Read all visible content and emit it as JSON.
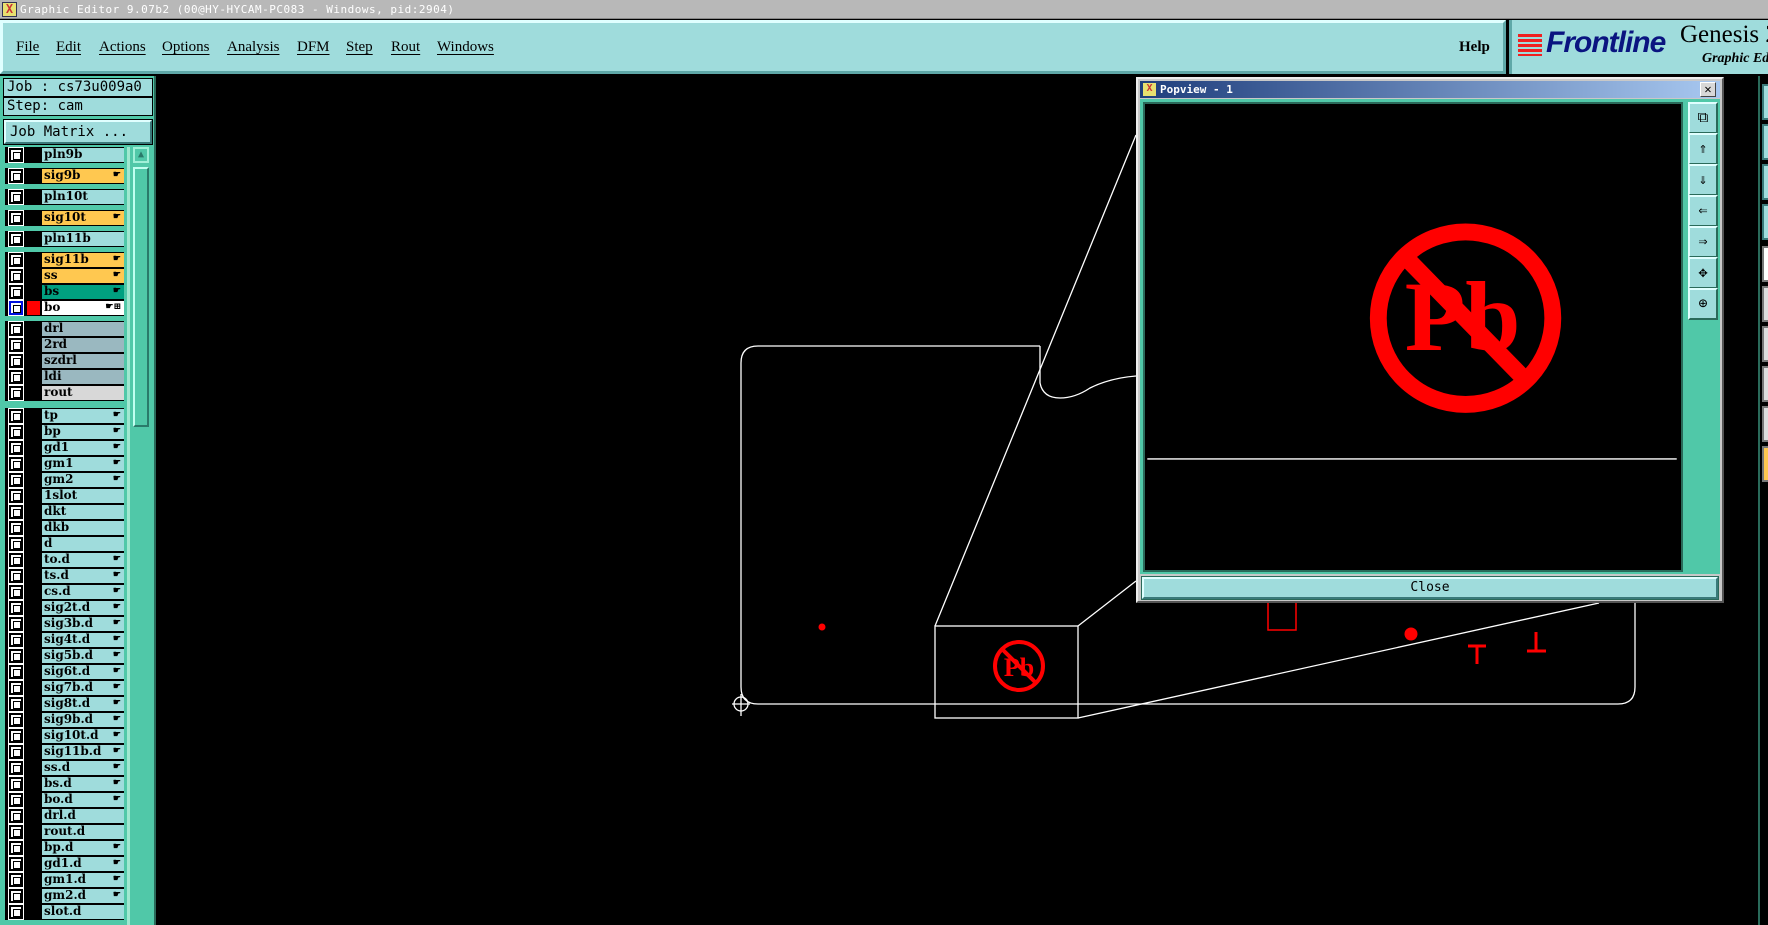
{
  "window": {
    "title": "Graphic Editor 9.07b2 (00@HY-HYCAM-PC083 - Windows, pid:2904)",
    "icon": "x-window-icon"
  },
  "menu": [
    "File",
    "Edit",
    "Actions",
    "Options",
    "Analysis",
    "DFM",
    "Step",
    "Rout",
    "Windows"
  ],
  "help": "Help",
  "logo": {
    "brand": "Frontline",
    "product": "Genesis 2",
    "subtitle": "Graphic Ed"
  },
  "job": {
    "job_label": "Job : cs73u009a0",
    "step_label": "Step: cam",
    "matrix_button": "Job Matrix ..."
  },
  "layer_colors": {
    "pln": "#9fdcdc",
    "sig": "#ffc850",
    "green": "#00a080",
    "white": "#ffffff",
    "gray": "#9ab8c0",
    "light": "#d8d8d8"
  },
  "layers": [
    {
      "name": "pln9b",
      "type": "pln"
    },
    {
      "name": "sig9b",
      "type": "sig",
      "hand": true,
      "gap": 5
    },
    {
      "name": "pln10t",
      "type": "pln",
      "gap": 5
    },
    {
      "name": "sig10t",
      "type": "sig",
      "hand": true,
      "gap": 5
    },
    {
      "name": "pln11b",
      "type": "pln",
      "gap": 5
    },
    {
      "name": "sig11b",
      "type": "sig",
      "hand": true,
      "gap": 5
    },
    {
      "name": "ss",
      "type": "sig",
      "hand": true
    },
    {
      "name": "bs",
      "type": "green",
      "hand": true
    },
    {
      "name": "bo",
      "type": "white",
      "hand": true,
      "active": true
    },
    {
      "name": "drl",
      "type": "gray",
      "gap": 5
    },
    {
      "name": "2rd",
      "type": "gray"
    },
    {
      "name": "szdrl",
      "type": "gray"
    },
    {
      "name": "ldi",
      "type": "gray"
    },
    {
      "name": "rout",
      "type": "light"
    },
    {
      "name": "tp",
      "type": "pln",
      "hand": true,
      "gap": 7
    },
    {
      "name": "bp",
      "type": "pln",
      "hand": true
    },
    {
      "name": "gd1",
      "type": "pln",
      "hand": true
    },
    {
      "name": "gm1",
      "type": "pln",
      "hand": true
    },
    {
      "name": "gm2",
      "type": "pln",
      "hand": true
    },
    {
      "name": "1slot",
      "type": "pln"
    },
    {
      "name": "dkt",
      "type": "pln"
    },
    {
      "name": "dkb",
      "type": "pln"
    },
    {
      "name": "d",
      "type": "pln"
    },
    {
      "name": "to.d",
      "type": "pln",
      "hand": true
    },
    {
      "name": "ts.d",
      "type": "pln",
      "hand": true
    },
    {
      "name": "cs.d",
      "type": "pln",
      "hand": true
    },
    {
      "name": "sig2t.d",
      "type": "pln",
      "hand": true
    },
    {
      "name": "sig3b.d",
      "type": "pln",
      "hand": true
    },
    {
      "name": "sig4t.d",
      "type": "pln",
      "hand": true
    },
    {
      "name": "sig5b.d",
      "type": "pln",
      "hand": true
    },
    {
      "name": "sig6t.d",
      "type": "pln",
      "hand": true
    },
    {
      "name": "sig7b.d",
      "type": "pln",
      "hand": true
    },
    {
      "name": "sig8t.d",
      "type": "pln",
      "hand": true
    },
    {
      "name": "sig9b.d",
      "type": "pln",
      "hand": true
    },
    {
      "name": "sig10t.d",
      "type": "pln",
      "hand": true
    },
    {
      "name": "sig11b.d",
      "type": "pln",
      "hand": true
    },
    {
      "name": "ss.d",
      "type": "pln",
      "hand": true
    },
    {
      "name": "bs.d",
      "type": "pln",
      "hand": true
    },
    {
      "name": "bo.d",
      "type": "pln",
      "hand": true
    },
    {
      "name": "drl.d",
      "type": "pln"
    },
    {
      "name": "rout.d",
      "type": "pln"
    },
    {
      "name": "bp.d",
      "type": "pln",
      "hand": true
    },
    {
      "name": "gd1.d",
      "type": "pln",
      "hand": true
    },
    {
      "name": "gm1.d",
      "type": "pln",
      "hand": true
    },
    {
      "name": "gm2.d",
      "type": "pln",
      "hand": true
    },
    {
      "name": "slot.d",
      "type": "pln"
    }
  ],
  "canvas": {
    "feature_color": "#ff0000",
    "outline_color": "#ffffff",
    "symbol_text": "Pb"
  },
  "popview": {
    "title": "Popview - 1",
    "close_label": "Close",
    "close_icon": "close-x-icon",
    "tools": [
      "zoom-window-icon",
      "pan-up-icon",
      "pan-down-icon",
      "pan-left-icon",
      "pan-right-icon",
      "zoom-out-icon",
      "zoom-fit-icon"
    ]
  }
}
